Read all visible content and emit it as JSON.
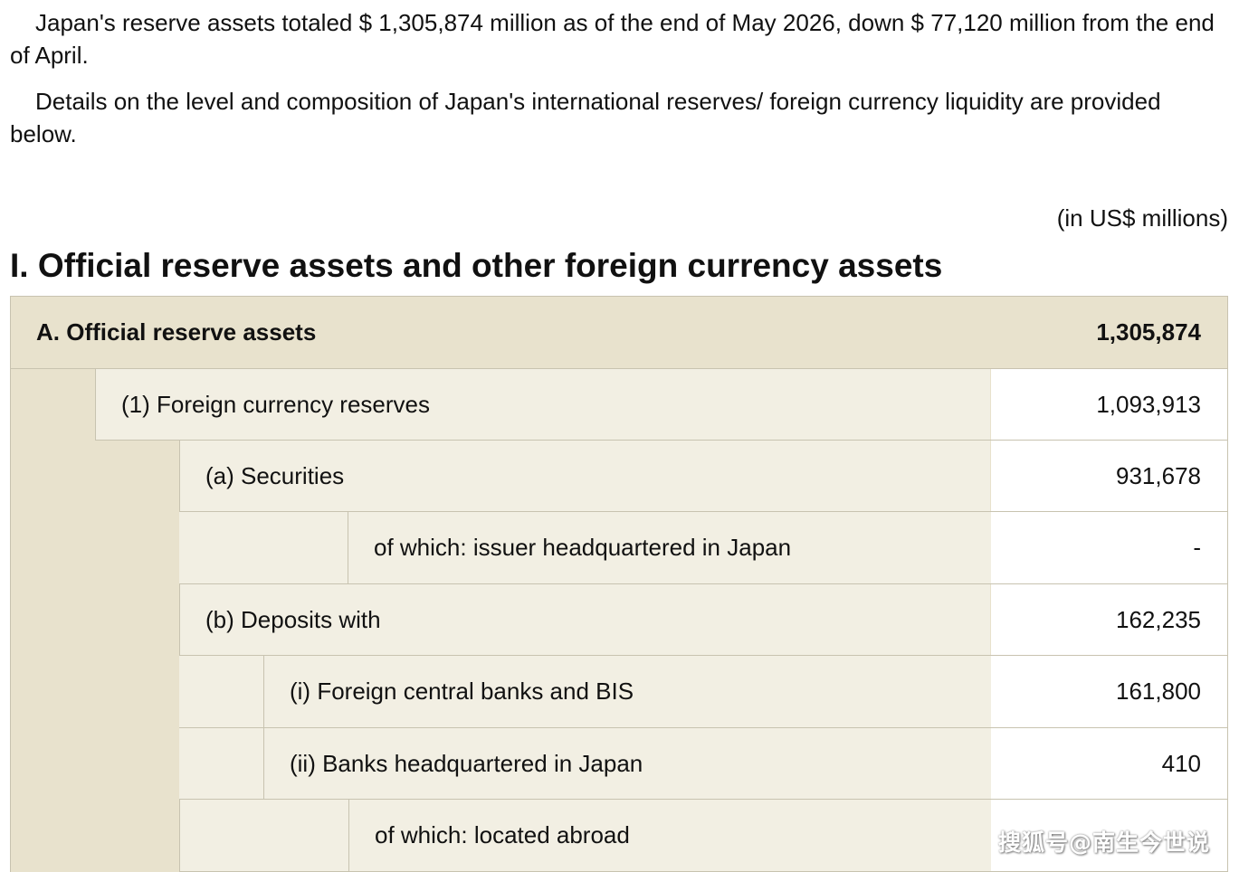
{
  "intro": {
    "paragraph1": "Japan's reserve assets totaled $ 1,305,874 million as of the end of May 2026, down $ 77,120 million from the end of April.",
    "paragraph2": "Details on the level and composition of Japan's international reserves/ foreign currency liquidity are provided below."
  },
  "units_note": "(in US$ millions)",
  "section_title": "I.  Official reserve assets and other foreign currency assets",
  "table": {
    "rows": [
      {
        "label": "A. Official reserve assets",
        "value": "1,305,874"
      },
      {
        "label": "(1) Foreign currency reserves",
        "value": "1,093,913"
      },
      {
        "label": "(a) Securities",
        "value": "931,678"
      },
      {
        "label": "of which: issuer headquartered in Japan",
        "value": "-"
      },
      {
        "label": "(b) Deposits with",
        "value": "162,235"
      },
      {
        "label": "(i) Foreign central banks and BIS",
        "value": "161,800"
      },
      {
        "label": "(ii) Banks headquartered in Japan",
        "value": "410"
      },
      {
        "label": "of which: located abroad",
        "value": ""
      }
    ]
  },
  "watermark": "搜狐号@南生今世说"
}
